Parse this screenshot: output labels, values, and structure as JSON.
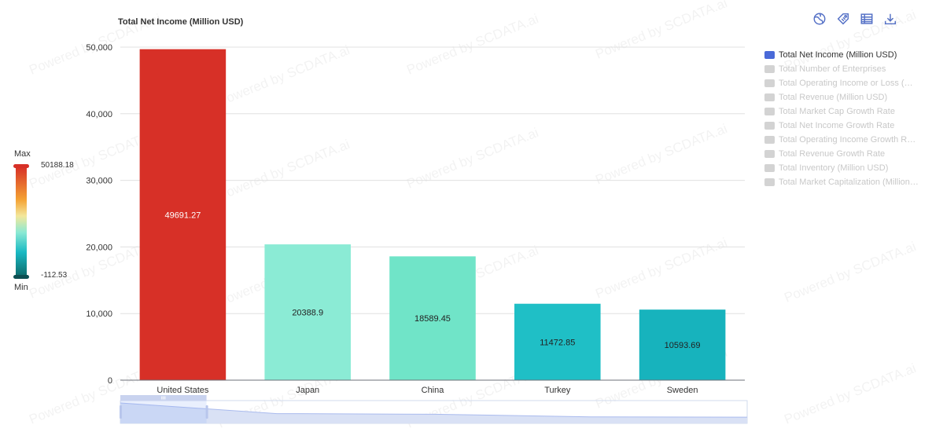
{
  "chart_data": {
    "type": "bar",
    "title": "Total Net Income (Million USD)",
    "categories": [
      "United States",
      "Japan",
      "China",
      "Turkey",
      "Sweden"
    ],
    "values": [
      49691.27,
      20388.9,
      18589.45,
      11472.85,
      10593.69
    ],
    "data_labels": [
      "49691.27",
      "20388.9",
      "18589.45",
      "11472.85",
      "10593.69"
    ],
    "ylim": [
      0,
      50000
    ],
    "yticks": [
      0,
      10000,
      20000,
      30000,
      40000,
      50000
    ],
    "ytick_labels": [
      "0",
      "10,000",
      "20,000",
      "30,000",
      "40,000",
      "50,000"
    ],
    "grid": true,
    "legend_position": "right",
    "bar_colors": [
      "#d73027",
      "#8bebd5",
      "#70e4c8",
      "#1fbfc6",
      "#17b3bd"
    ],
    "visual_map": {
      "max_label": "Max",
      "min_label": "Min",
      "max_value": "50188.18",
      "min_value": "-112.53"
    }
  },
  "watermark": "Powered by SCDATA.ai",
  "legend": {
    "items": [
      {
        "label": "Total Net Income (Million USD)",
        "active": true
      },
      {
        "label": "Total Number of Enterprises",
        "active": false
      },
      {
        "label": "Total Operating Income or Loss (Million USD)",
        "active": false
      },
      {
        "label": "Total Revenue (Million USD)",
        "active": false
      },
      {
        "label": "Total Market Cap Growth Rate",
        "active": false
      },
      {
        "label": "Total Net Income Growth Rate",
        "active": false
      },
      {
        "label": "Total Operating Income Growth Rate",
        "active": false
      },
      {
        "label": "Total Revenue Growth Rate",
        "active": false
      },
      {
        "label": "Total Inventory (Million USD)",
        "active": false
      },
      {
        "label": "Total Market Capitalization (Million USD)",
        "active": false
      }
    ]
  },
  "toolbar": {
    "icons": [
      "map-icon",
      "tag-icon",
      "table-icon",
      "download-icon"
    ],
    "color": "#5470c6"
  }
}
